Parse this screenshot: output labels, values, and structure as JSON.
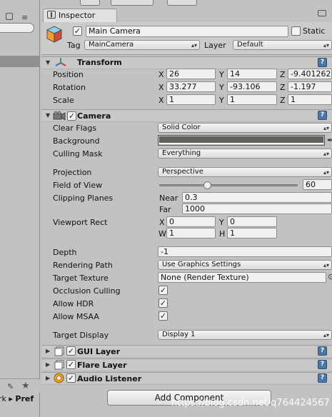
{
  "left_panel": {
    "menu_glyph": "≡",
    "tag_glyph": "✎",
    "star_glyph": "★",
    "crumb_prefix": "rk  ▸ ",
    "crumb_bold": "Pref"
  },
  "tab": {
    "label": "Inspector"
  },
  "object": {
    "name": "Main Camera",
    "active_checked": "✓",
    "static_label": "Static",
    "tag_label": "Tag",
    "tag_value": "MainCamera",
    "layer_label": "Layer",
    "layer_value": "Default"
  },
  "transform": {
    "title": "Transform",
    "position_label": "Position",
    "rotation_label": "Rotation",
    "scale_label": "Scale",
    "x": "X",
    "y": "Y",
    "z": "Z",
    "position": {
      "x": "26",
      "y": "14",
      "z": "-9.401262"
    },
    "rotation": {
      "x": "33.277",
      "y": "-93.106",
      "z": "-1.197"
    },
    "scale": {
      "x": "1",
      "y": "1",
      "z": "1"
    }
  },
  "camera": {
    "title": "Camera",
    "clear_flags_label": "Clear Flags",
    "clear_flags_value": "Solid Color",
    "background_label": "Background",
    "background_color": "#5f625c",
    "culling_mask_label": "Culling Mask",
    "culling_mask_value": "Everything",
    "projection_label": "Projection",
    "projection_value": "Perspective",
    "fov_label": "Field of View",
    "fov_value": "60",
    "fov_fraction": 0.35,
    "clipping_label": "Clipping Planes",
    "near_label": "Near",
    "near_value": "0.3",
    "far_label": "Far",
    "far_value": "1000",
    "viewport_label": "Viewport Rect",
    "vx_label": "X",
    "vx": "0",
    "vy_label": "Y",
    "vy": "0",
    "vw_label": "W",
    "vw": "1",
    "vh_label": "H",
    "vh": "1",
    "depth_label": "Depth",
    "depth_value": "-1",
    "rendering_path_label": "Rendering Path",
    "rendering_path_value": "Use Graphics Settings",
    "target_texture_label": "Target Texture",
    "target_texture_value": "None (Render Texture)",
    "target_texture_picker": "⊙",
    "occlusion_label": "Occlusion Culling",
    "hdr_label": "Allow HDR",
    "msaa_label": "Allow MSAA",
    "check": "✓",
    "target_display_label": "Target Display",
    "target_display_value": "Display 1"
  },
  "components": {
    "gui_layer": "GUI Layer",
    "flare_layer": "Flare Layer",
    "audio_listener": "Audio Listener"
  },
  "help_glyph": "?",
  "gear_glyph": "⚙",
  "dropdown_arrow": "▴▾",
  "add_component_label": "Add Component",
  "watermark": "https://blog.csdn.net/q764424567"
}
